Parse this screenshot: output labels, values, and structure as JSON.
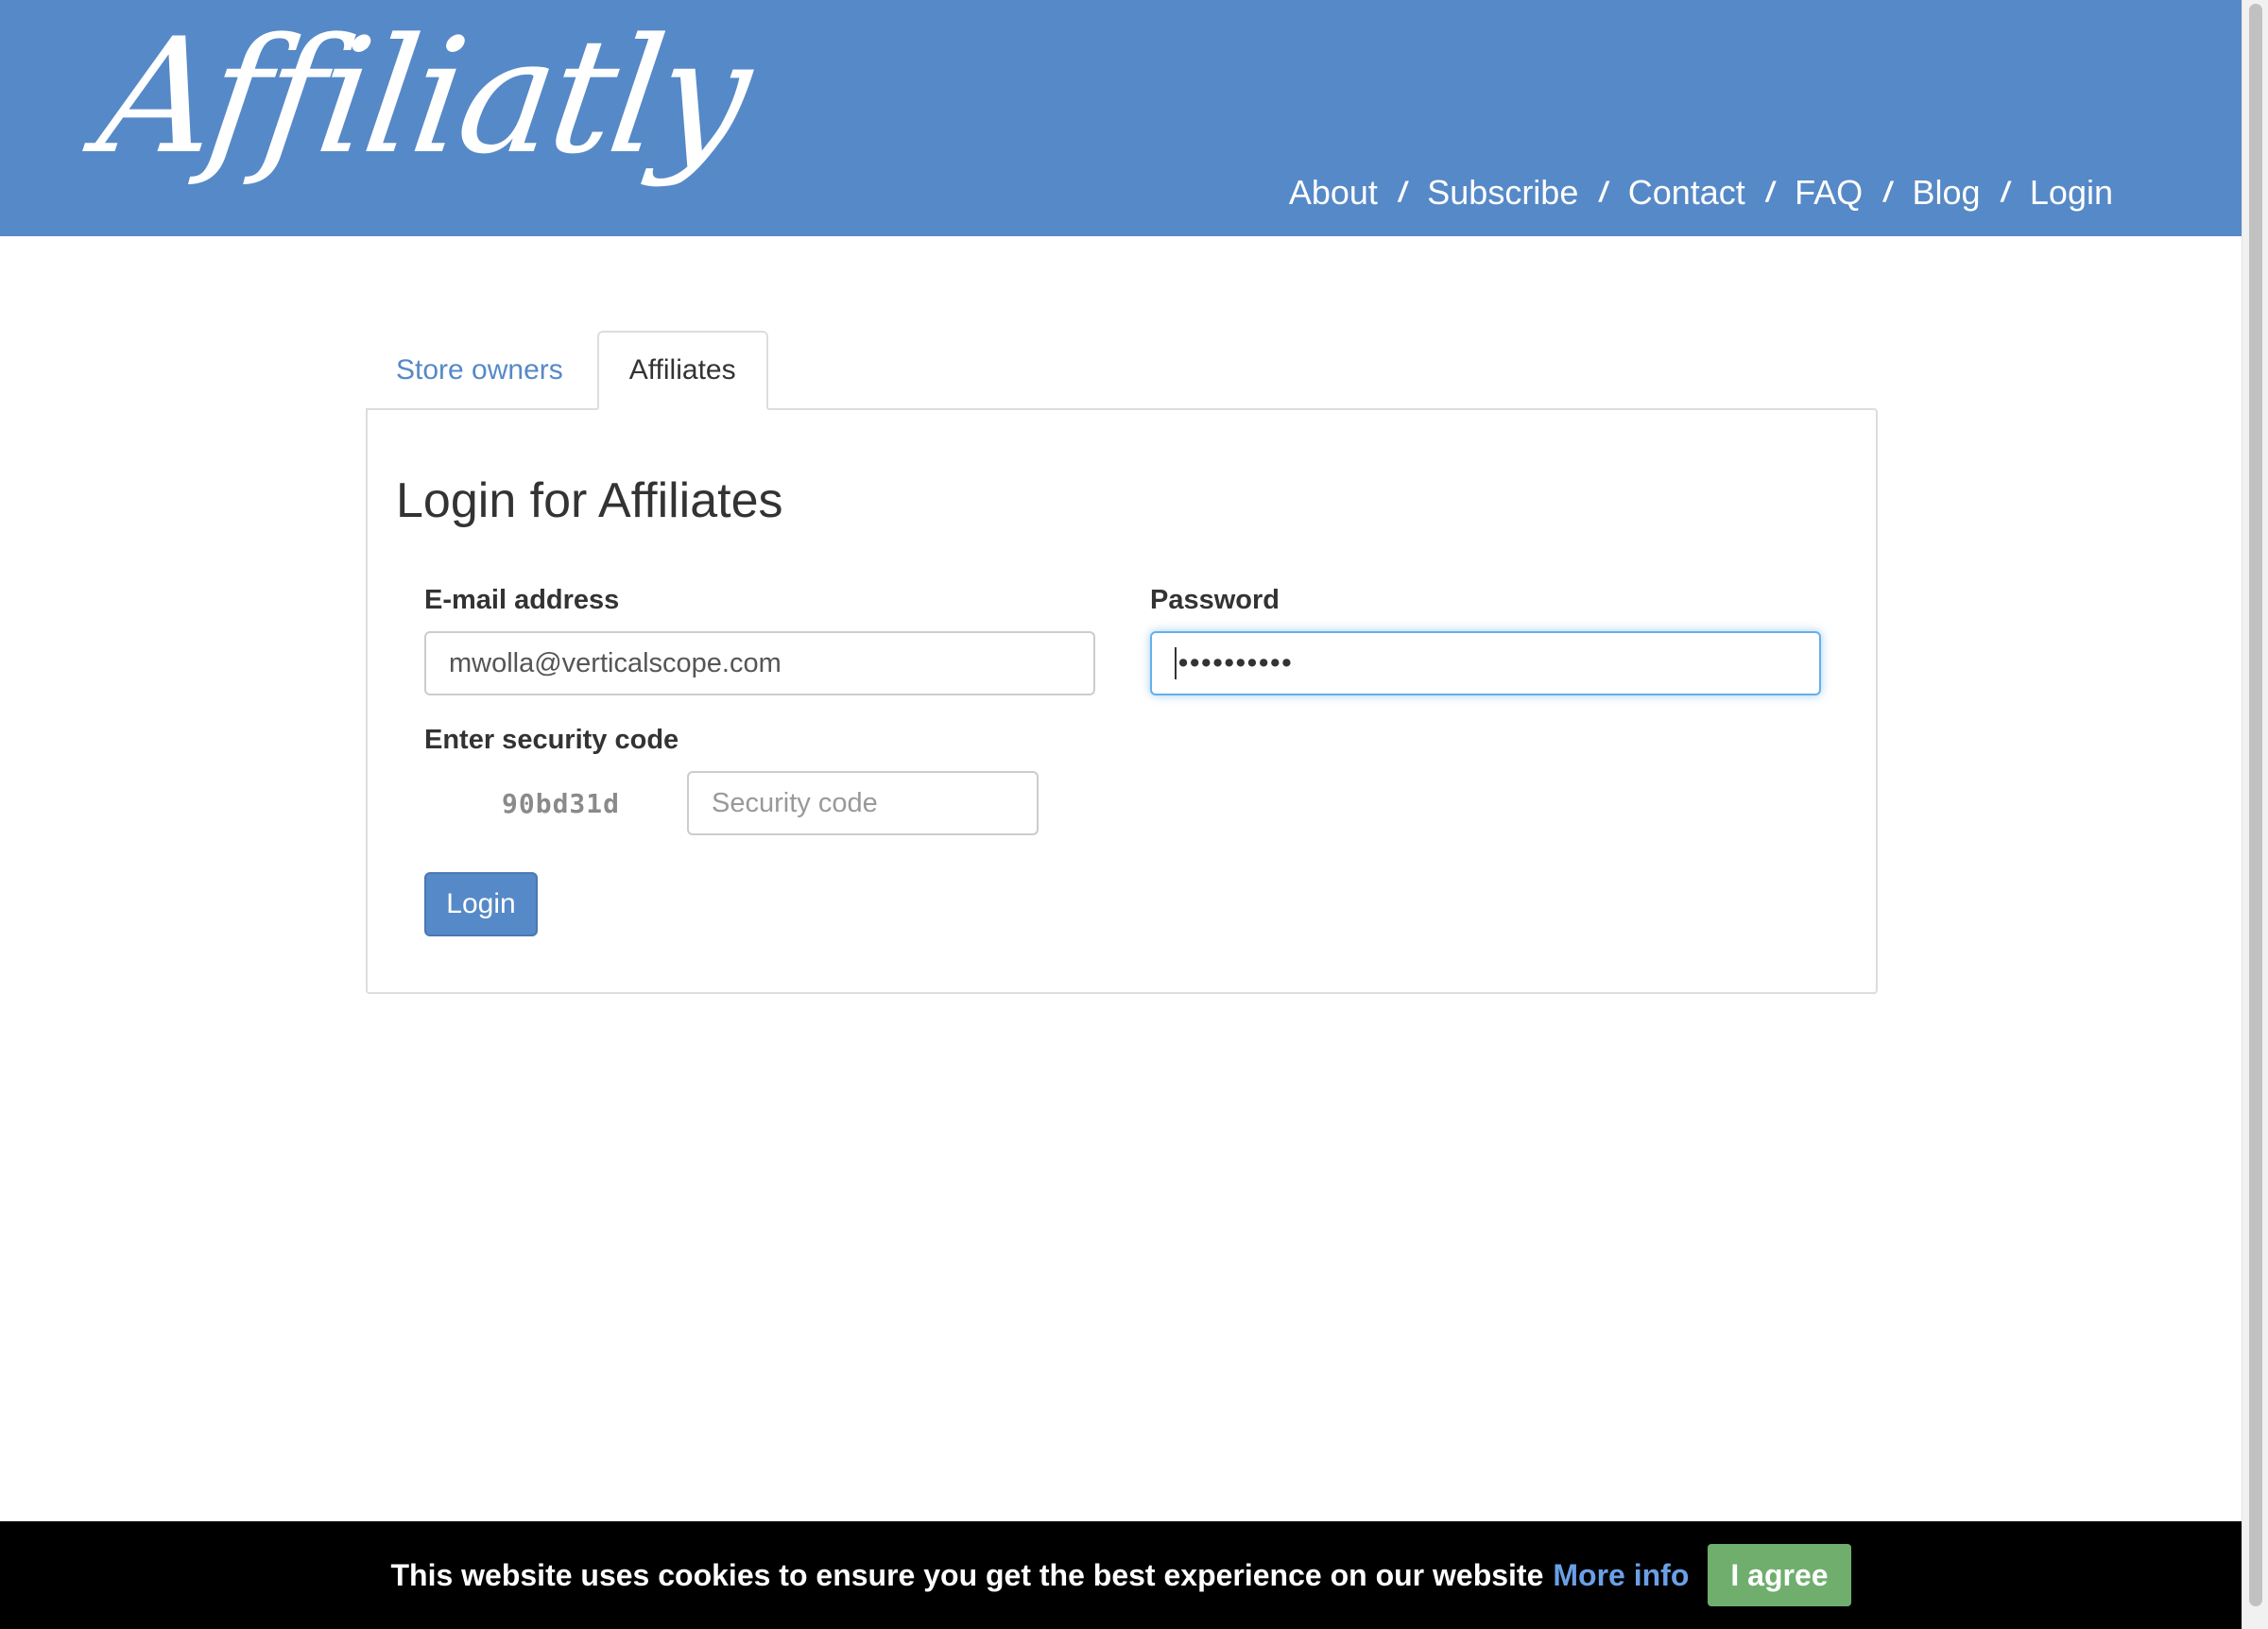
{
  "header": {
    "logo": "Affiliatly",
    "background": "#5689c7",
    "nav": {
      "about": "About",
      "subscribe": "Subscribe",
      "contact": "Contact",
      "faq": "FAQ",
      "blog": "Blog",
      "login": "Login",
      "separator": "/"
    }
  },
  "tabs": {
    "store_owners": "Store owners",
    "affiliates": "Affiliates",
    "active": "Affiliates"
  },
  "form": {
    "title": "Login for Affiliates",
    "email_label": "E-mail address",
    "email_value": "mwolla@verticalscope.com",
    "password_label": "Password",
    "password_mask": "••••••••••",
    "security_label": "Enter security code",
    "security_code": "90bd31d",
    "security_placeholder": "Security code",
    "login_button": "Login"
  },
  "cookie": {
    "message": "This website uses cookies to ensure you get the best experience on our website",
    "more_info": "More info",
    "agree": "I agree"
  }
}
